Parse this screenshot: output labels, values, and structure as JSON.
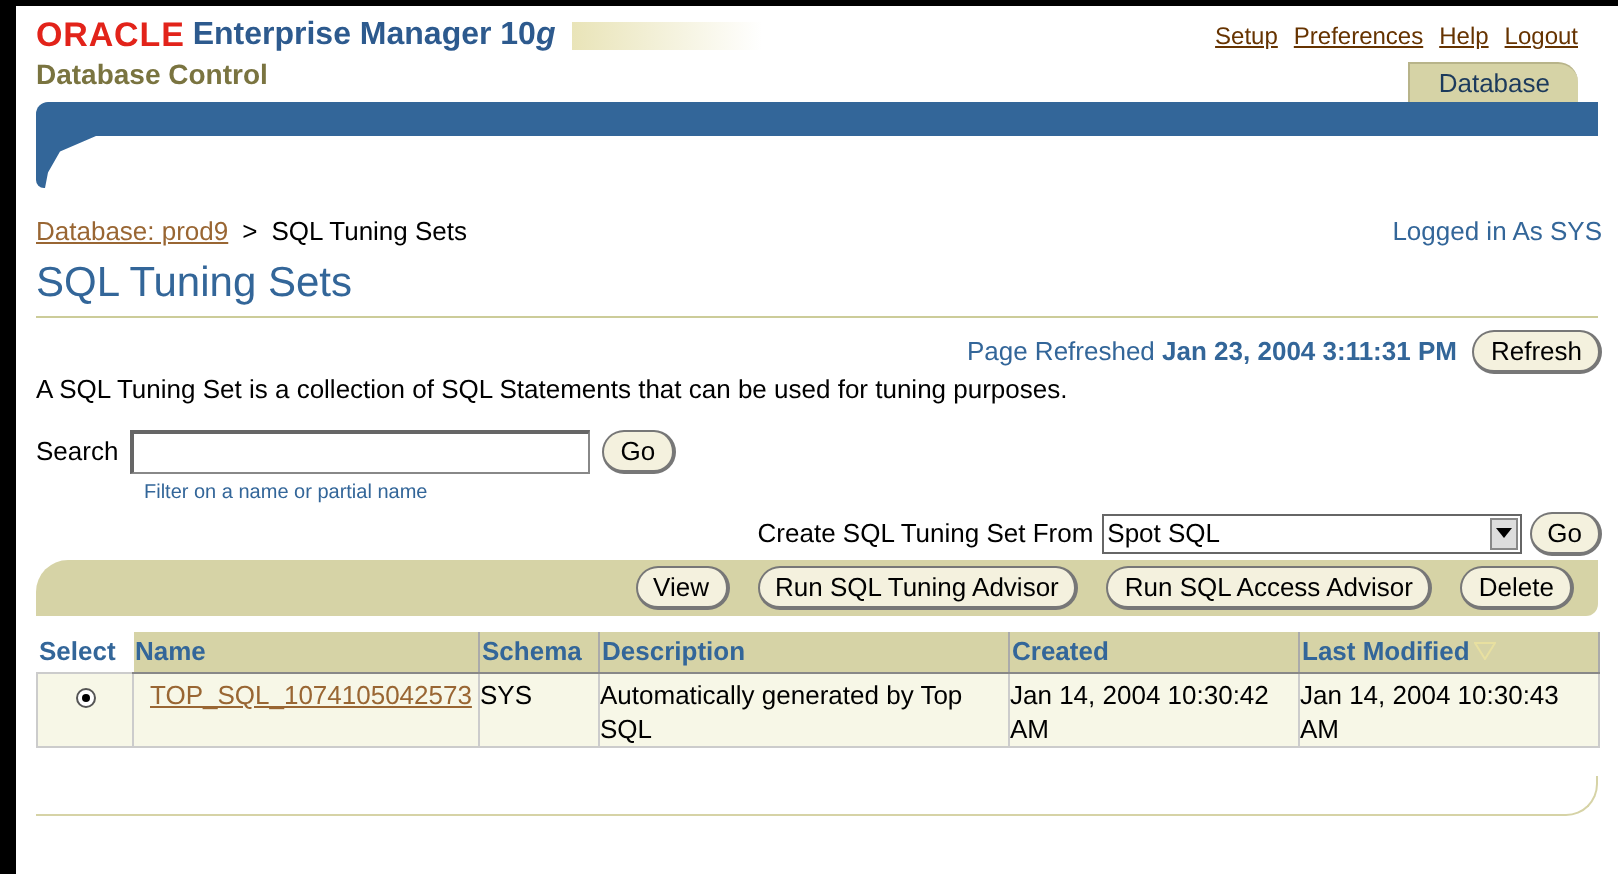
{
  "branding": {
    "logo": "ORACLE",
    "product": "Enterprise Manager 10",
    "product_suffix": "g",
    "subtitle": "Database Control"
  },
  "global_links": [
    "Setup",
    "Preferences",
    "Help",
    "Logout"
  ],
  "tabs": [
    {
      "label": "Database",
      "selected": true
    }
  ],
  "breadcrumb": {
    "link": "Database: prod9",
    "separator": ">",
    "current": "SQL Tuning Sets"
  },
  "login_status": "Logged in As SYS",
  "page_title": "SQL Tuning Sets",
  "refresh": {
    "label": "Page Refreshed",
    "timestamp": "Jan 23, 2004 3:11:31 PM",
    "button": "Refresh"
  },
  "description": "A SQL Tuning Set is a collection of SQL Statements that can be used for tuning purposes.",
  "search": {
    "label": "Search",
    "button": "Go",
    "hint": "Filter on a name or partial name"
  },
  "create": {
    "label": "Create SQL Tuning Set From",
    "value": "Spot SQL",
    "button": "Go"
  },
  "actions": [
    "View",
    "Run SQL Tuning Advisor",
    "Run SQL Access Advisor",
    "Delete"
  ],
  "table": {
    "columns": [
      {
        "label": "Select",
        "sorted": false
      },
      {
        "label": "Name",
        "sorted": false
      },
      {
        "label": "Schema",
        "sorted": false
      },
      {
        "label": "Description",
        "sorted": false
      },
      {
        "label": "Created",
        "sorted": false
      },
      {
        "label": "Last Modified",
        "sorted": true
      }
    ],
    "rows": [
      {
        "selected": true,
        "name": "TOP_SQL_1074105042573",
        "schema": "SYS",
        "description": "Automatically generated by Top SQL",
        "created": "Jan 14, 2004 10:30:42 AM",
        "last_modified": "Jan 14, 2004 10:30:43 AM"
      }
    ]
  }
}
